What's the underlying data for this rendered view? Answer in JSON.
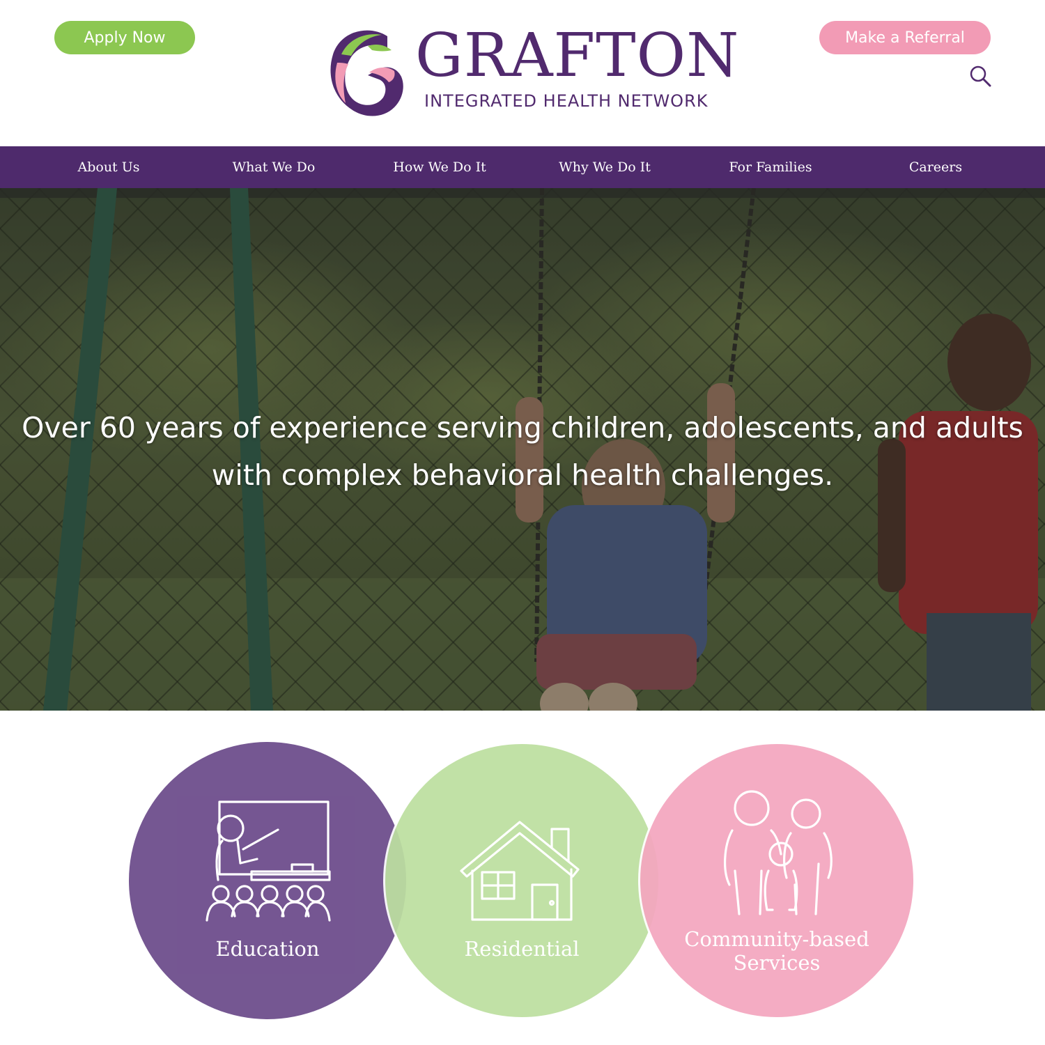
{
  "colors": {
    "brand_purple": "#512a6e",
    "nav_bg": "#4e2a6c",
    "apply_green": "#8cc751",
    "referral_pink": "#f29bb5",
    "education_purple": "#6b4a8a",
    "residential_green": "#bddfa0",
    "community_pink": "#f4a6bf"
  },
  "header": {
    "apply_label": "Apply Now",
    "referral_label": "Make a Referral",
    "search_icon": "search-icon",
    "logo": {
      "title": "GRAFTON",
      "subtitle": "INTEGRATED HEALTH NETWORK"
    }
  },
  "nav": {
    "items": [
      {
        "label": "About Us"
      },
      {
        "label": "What We Do"
      },
      {
        "label": "How We Do It"
      },
      {
        "label": "Why We Do It"
      },
      {
        "label": "For Families"
      },
      {
        "label": "Careers"
      }
    ]
  },
  "hero": {
    "line1": "Over 60 years of experience serving children, adolescents, and adults",
    "line2": "with complex behavioral health challenges."
  },
  "services": [
    {
      "label": "Education",
      "icon": "classroom-teacher-icon"
    },
    {
      "label": "Residential",
      "icon": "house-icon"
    },
    {
      "label_line1": "Community-based",
      "label_line2": "Services",
      "icon": "family-icon"
    }
  ]
}
